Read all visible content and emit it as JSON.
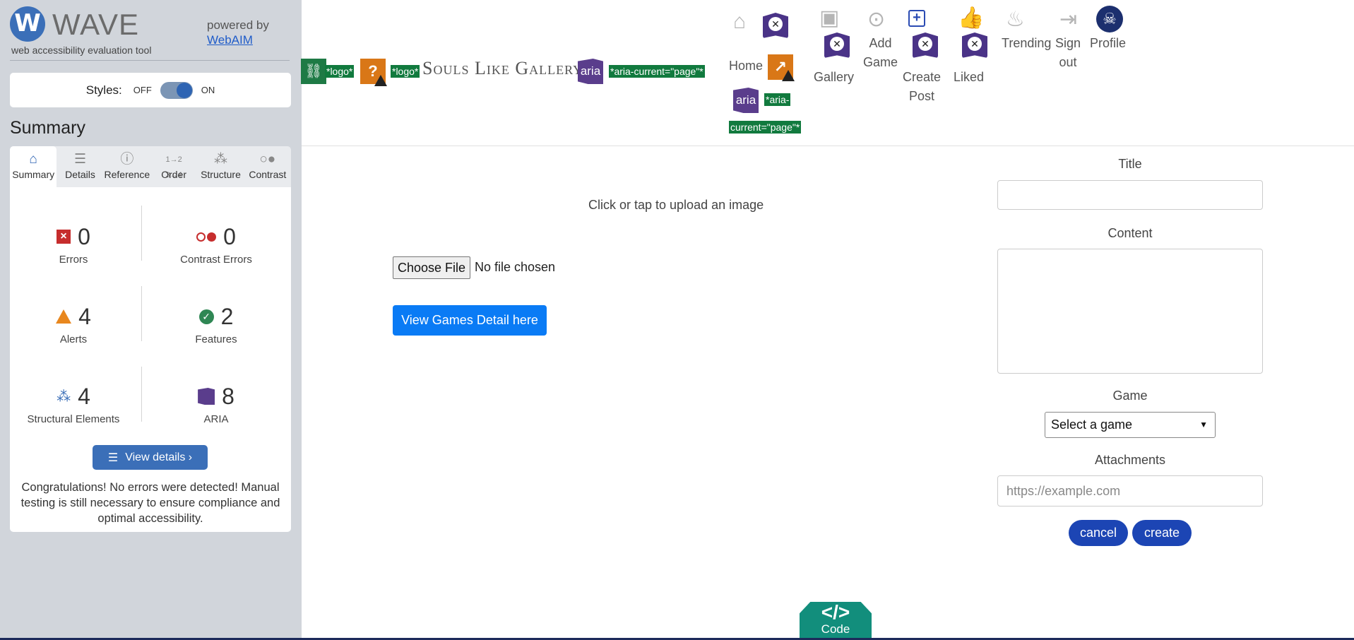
{
  "wave": {
    "logo_letter": "W",
    "title": "WAVE",
    "subtitle": "web accessibility evaluation tool",
    "powered_by": "powered by",
    "webaim_link": "WebAIM",
    "styles_label": "Styles:",
    "styles_off": "OFF",
    "styles_on": "ON",
    "styles_enabled": true,
    "summary_title": "Summary",
    "tabs": [
      {
        "label": "Summary",
        "icon": "home-icon",
        "active": true
      },
      {
        "label": "Details",
        "icon": "list-icon"
      },
      {
        "label": "Reference",
        "icon": "info-icon"
      },
      {
        "label": "Order",
        "icon": "order-icon"
      },
      {
        "label": "Structure",
        "icon": "structure-icon"
      },
      {
        "label": "Contrast",
        "icon": "contrast-icon"
      }
    ],
    "stats": {
      "errors": {
        "count": "0",
        "label": "Errors"
      },
      "contrast": {
        "count": "0",
        "label": "Contrast Errors"
      },
      "alerts": {
        "count": "4",
        "label": "Alerts"
      },
      "features": {
        "count": "2",
        "label": "Features"
      },
      "structural": {
        "count": "4",
        "label": "Structural Elements"
      },
      "aria": {
        "count": "8",
        "label": "ARIA"
      }
    },
    "view_details": "View details ›",
    "congrats": "Congratulations! No errors were detected! Manual testing is still necessary to ensure compliance and optimal accessibility."
  },
  "colors": {
    "wave_blue": "#3b6fb8",
    "wave_sidebar": "#d1d5db",
    "error_red": "#c62d2d",
    "alert_orange": "#e8871e",
    "feature_green": "#2f8754",
    "aria_purple": "#5a3d8c",
    "tag_green": "#117a3e",
    "page_button_blue": "#0a7bf5",
    "pill_blue": "#1c45b4",
    "code_teal": "#128e7c"
  },
  "page": {
    "tags": {
      "logo1": "*logo*",
      "logo2": "*logo*",
      "aria_current1": "*aria-current=\"page\"*",
      "aria_current2a": "*aria-",
      "aria_current2b": "current=\"page\"*",
      "aria": "aria"
    },
    "brand": "Souls Like Gallery",
    "nav": {
      "home": "Home",
      "gallery": "Gallery",
      "add_game_1": "Add",
      "add_game_2": "Game",
      "create_post_1": "Create",
      "create_post_2": "Post",
      "liked": "Liked",
      "trending": "Trending",
      "sign_out_1": "Sign",
      "sign_out_2": "out",
      "profile": "Profile"
    },
    "upload_text": "Click or tap to upload an image",
    "choose_file": "Choose File",
    "no_file": "No file chosen",
    "view_games_button": "View Games Detail here",
    "form": {
      "title_label": "Title",
      "title_value": "",
      "content_label": "Content",
      "content_value": "",
      "game_label": "Game",
      "game_selected": "Select a game",
      "attachments_label": "Attachments",
      "attachments_placeholder": "https://example.com",
      "cancel": "cancel",
      "create": "create"
    },
    "code_badge": {
      "symbol": "</>",
      "label": "Code"
    }
  }
}
